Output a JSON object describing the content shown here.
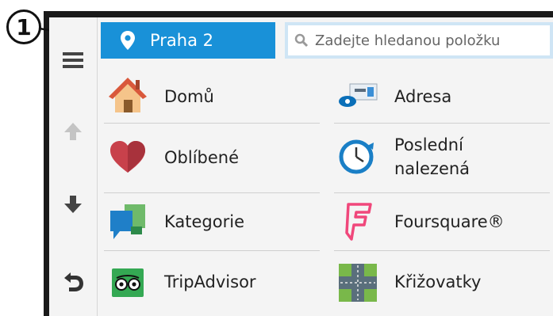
{
  "callout": {
    "number": "1"
  },
  "header": {
    "location_label": "Praha 2",
    "search_placeholder": "Zadejte hledanou položku"
  },
  "sidebar": {
    "menu_icon": "hamburger-menu-icon",
    "up_icon": "arrow-up-icon",
    "down_icon": "arrow-down-icon",
    "back_icon": "back-arrow-icon"
  },
  "categories": [
    {
      "label": "Domů",
      "icon": "home-icon"
    },
    {
      "label": "Adresa",
      "icon": "address-icon"
    },
    {
      "label": "Oblíbené",
      "icon": "heart-icon"
    },
    {
      "label_line1": "Poslední",
      "label_line2": "nalezená",
      "icon": "clock-icon"
    },
    {
      "label": "Kategorie",
      "icon": "category-icon"
    },
    {
      "label": "Foursquare®",
      "icon": "foursquare-icon"
    },
    {
      "label": "TripAdvisor",
      "icon": "tripadvisor-icon"
    },
    {
      "label": "Křižovatky",
      "icon": "intersection-icon"
    }
  ],
  "colors": {
    "accent": "#1991d8",
    "search_border": "#cfe5f5",
    "bezel": "#1a1a1a"
  }
}
